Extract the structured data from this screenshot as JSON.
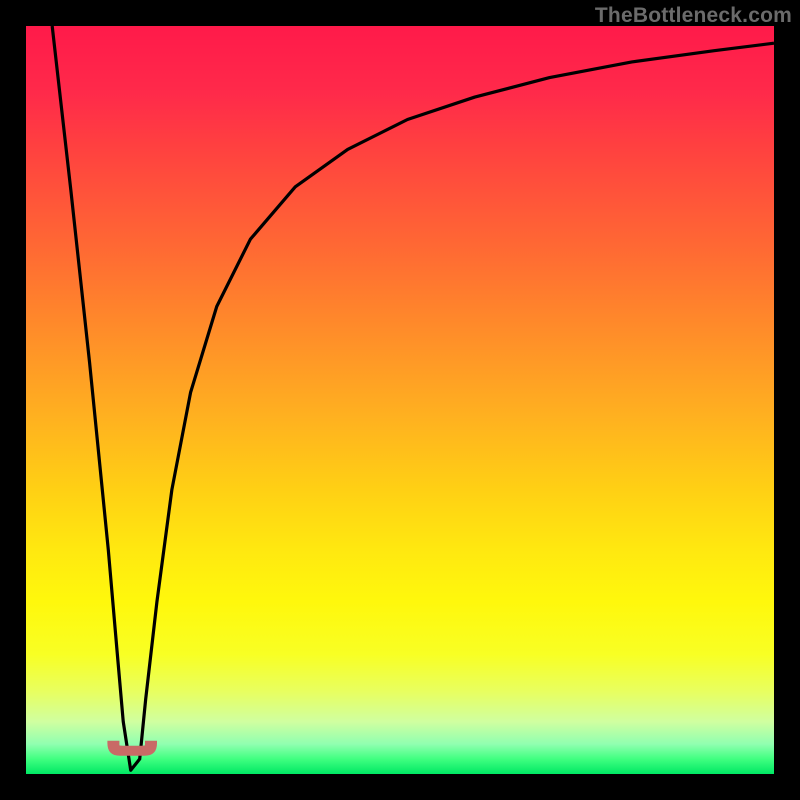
{
  "watermark": "TheBottleneck.com",
  "colors": {
    "frame": "#000000",
    "curve_stroke": "#000000",
    "bump_fill": "#c96a66",
    "bump_stroke": "#c96a66",
    "gradient_top": "#ff1a4a",
    "gradient_bottom": "#00e864"
  },
  "chart_data": {
    "type": "line",
    "title": "",
    "xlabel": "",
    "ylabel": "",
    "xlim": [
      0,
      100
    ],
    "ylim": [
      0,
      100
    ],
    "grid": false,
    "legend": false,
    "annotations": [
      {
        "kind": "bump-marker",
        "x_center": 14.2,
        "width": 6.5,
        "y": 2.5
      }
    ],
    "series": [
      {
        "name": "v-curve",
        "x": [
          3.5,
          6.0,
          8.5,
          11.0,
          12.3,
          13.0,
          14.0,
          15.2,
          16.0,
          17.5,
          19.5,
          22.0,
          25.5,
          30.0,
          36.0,
          43.0,
          51.0,
          60.0,
          70.0,
          81.0,
          92.0,
          100.0
        ],
        "values": [
          100,
          78.0,
          55.0,
          30.0,
          15.0,
          7.0,
          0.5,
          2.0,
          10.0,
          23.0,
          38.0,
          51.0,
          62.5,
          71.5,
          78.5,
          83.5,
          87.5,
          90.5,
          93.1,
          95.2,
          96.7,
          97.7
        ]
      }
    ]
  }
}
